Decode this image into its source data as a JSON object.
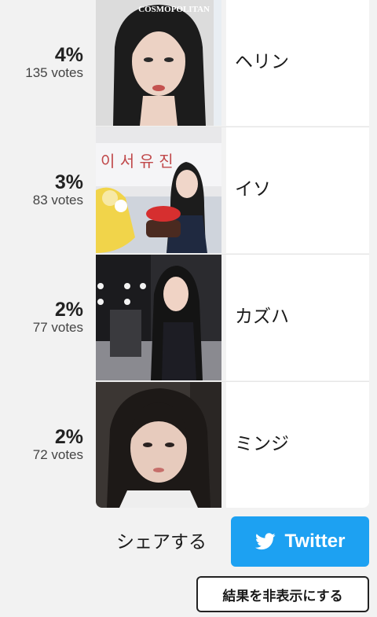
{
  "results": [
    {
      "percent": "4%",
      "votes": "135 votes",
      "name": "ヘリン",
      "magazine": "COSMOPOLITAN"
    },
    {
      "percent": "3%",
      "votes": "83 votes",
      "name": "イソ",
      "sign_text": "이 서 유 진"
    },
    {
      "percent": "2%",
      "votes": "77 votes",
      "name": "カズハ"
    },
    {
      "percent": "2%",
      "votes": "72 votes",
      "name": "ミンジ"
    }
  ],
  "share": {
    "label": "シェアする",
    "twitter_label": "Twitter",
    "twitter_icon": "twitter-bird-icon"
  },
  "hide_results_label": "結果を非表示にする",
  "colors": {
    "background": "#f2f2f2",
    "twitter_blue": "#1da1f2",
    "cell_background": "#ffffff"
  }
}
